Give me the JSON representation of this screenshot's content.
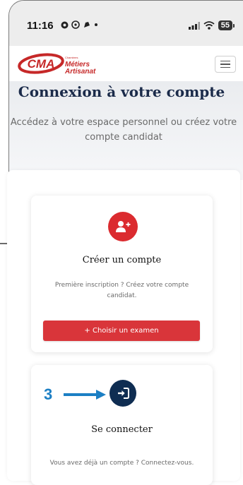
{
  "status_bar": {
    "time": "11:16",
    "battery": "55"
  },
  "header": {
    "logo_mark": "CMA",
    "logo_line1": "Chambres",
    "logo_line2": "Métiers",
    "logo_line3": "Artisanat",
    "menu_icon": "hamburger-menu-icon"
  },
  "page": {
    "title": "Connexion à votre compte",
    "subtitle": "Accédez à votre espace personnel ou créez votre compte candidat"
  },
  "create_card": {
    "icon": "add-user-icon",
    "title": "Créer un compte",
    "text": "Première inscription ? Créez votre compte candidat.",
    "button_label": "+ Choisir un examen"
  },
  "login_card": {
    "icon": "login-icon",
    "title": "Se connecter",
    "text": "Vous avez déjà un compte ? Connectez-vous."
  },
  "annotation": {
    "step_number": "3"
  },
  "colors": {
    "brand_red": "#db2b2f",
    "navy": "#0f2d52",
    "annotation_blue": "#1c7fc4"
  }
}
